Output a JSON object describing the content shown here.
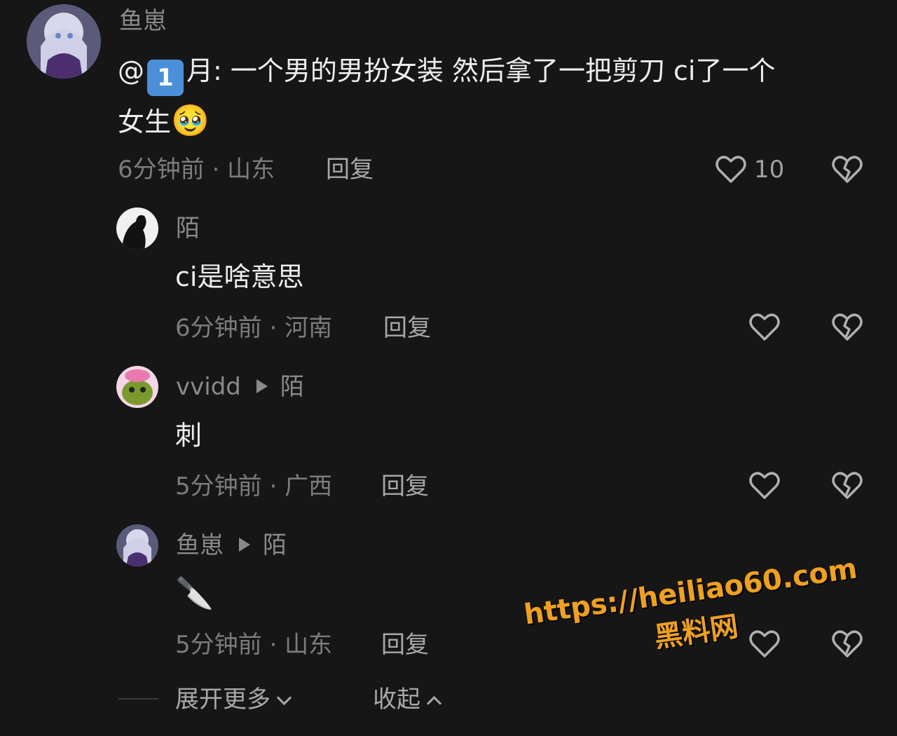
{
  "comment": {
    "author": "鱼崽",
    "mention": "@",
    "mention_badge": "1",
    "text_line1": "月: 一个男的男扮女装 然后拿了一把剪刀 ci了一个",
    "text_line2": "女生",
    "emoji_line2": "🥹",
    "time": "6分钟前",
    "location": "山东",
    "reply_label": "回复",
    "like_count": "10"
  },
  "replies": [
    {
      "author": "陌",
      "reply_to": "",
      "text": "ci是啥意思",
      "time": "6分钟前",
      "location": "河南",
      "reply_label": "回复"
    },
    {
      "author": "vvidd",
      "reply_to": "陌",
      "text": "刺",
      "time": "5分钟前",
      "location": "广西",
      "reply_label": "回复"
    },
    {
      "author": "鱼崽",
      "reply_to": "陌",
      "text": "🔪",
      "time": "5分钟前",
      "location": "山东",
      "reply_label": "回复"
    }
  ],
  "footer": {
    "expand_label": "展开更多",
    "collapse_label": "收起"
  },
  "watermark": {
    "url": "https://heiliao60.com",
    "site": "黑料网"
  },
  "separator": " · ",
  "icons": {
    "like": "heart-outline-icon",
    "dislike": "broken-heart-icon",
    "arrow": "reply-arrow-icon",
    "knife": "knife-icon"
  },
  "colors": {
    "background": "#161616",
    "watermark": "#f0a020",
    "mention_badge": "#4a8fd8"
  }
}
